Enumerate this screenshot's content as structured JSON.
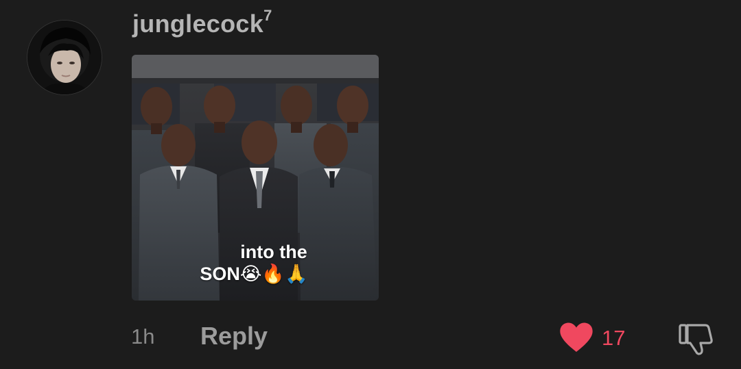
{
  "comment": {
    "username": "junglecock",
    "username_badge": "7",
    "attachment_caption_line1": "into the",
    "attachment_caption_line2": "SON😭🔥🙏",
    "time": "1h",
    "reply_label": "Reply",
    "like_count": "17",
    "liked": true
  },
  "icons": {
    "avatar": "profile-photo",
    "like": "heart-icon",
    "dislike": "thumbs-down-icon"
  },
  "colors": {
    "background": "#1c1c1c",
    "like_accent": "#f0485f",
    "username": "#b5b5b5",
    "secondary_text": "#8a8a8a"
  }
}
